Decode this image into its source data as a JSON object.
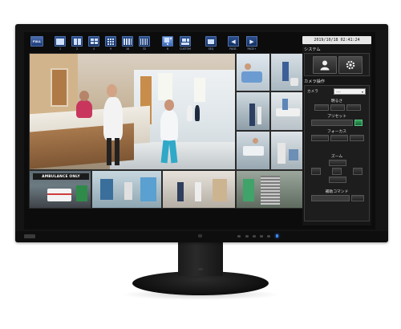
{
  "toolbar": {
    "full_label": "FULL",
    "layouts": [
      {
        "label": "1"
      },
      {
        "label": "2"
      },
      {
        "label": "4"
      },
      {
        "label": "9"
      },
      {
        "label": "16"
      },
      {
        "label": "32"
      },
      {
        "label": "6"
      },
      {
        "label": "CUSTOM"
      },
      {
        "label": "SEQ"
      }
    ],
    "page_prev": "PAGE-",
    "page_next": "PAGE+"
  },
  "camera_signage": {
    "ambulance_only": "AMBULANCE ONLY"
  },
  "panel": {
    "datetime": "2019/10/18 02:41:24",
    "system_label": "システム",
    "camera_ops_label": "カメラ操作",
    "camera_label": "カメラ",
    "camera_select_value": "----",
    "brightness_label": "明るさ",
    "preset_label": "プリセット",
    "focus_label": "フォーカス",
    "zoom_label": "ズーム",
    "aux_command_label": "補助コマンド"
  },
  "icons": {
    "user": "user-icon",
    "settings": "gear-icon",
    "arrow_left": "arrow-left-icon",
    "arrow_right": "arrow-right-icon"
  },
  "colors": {
    "toolbar_blue": "#2b4f8f",
    "active_green": "#34a05a",
    "led_blue": "#3c8bff"
  }
}
